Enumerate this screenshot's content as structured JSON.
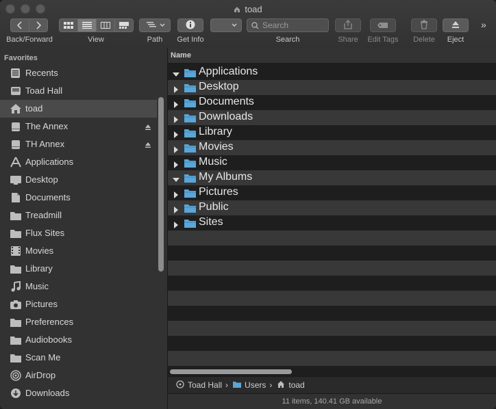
{
  "window": {
    "title": "toad"
  },
  "toolbar": {
    "back_forward_label": "Back/Forward",
    "view_label": "View",
    "path_label": "Path",
    "get_info_label": "Get Info",
    "search_label": "Search",
    "search_placeholder": "Search",
    "share_label": "Share",
    "edit_tags_label": "Edit Tags",
    "delete_label": "Delete",
    "eject_label": "Eject",
    "more_label": "»"
  },
  "sidebar": {
    "heading": "Favorites",
    "items": [
      {
        "label": "Recents",
        "icon": "recents-icon"
      },
      {
        "label": "Toad Hall",
        "icon": "disk-icon"
      },
      {
        "label": "toad",
        "icon": "home-icon",
        "selected": true
      },
      {
        "label": "The Annex",
        "icon": "drive-icon",
        "eject": true
      },
      {
        "label": "TH Annex",
        "icon": "drive-icon",
        "eject": true
      },
      {
        "label": "Applications",
        "icon": "applications-icon"
      },
      {
        "label": "Desktop",
        "icon": "desktop-icon"
      },
      {
        "label": "Documents",
        "icon": "document-icon"
      },
      {
        "label": "Treadmill",
        "icon": "folder-icon"
      },
      {
        "label": "Flux Sites",
        "icon": "folder-icon"
      },
      {
        "label": "Movies",
        "icon": "movies-icon"
      },
      {
        "label": "Library",
        "icon": "folder-icon"
      },
      {
        "label": "Music",
        "icon": "music-icon"
      },
      {
        "label": "Pictures",
        "icon": "camera-icon"
      },
      {
        "label": "Preferences",
        "icon": "folder-icon"
      },
      {
        "label": "Audiobooks",
        "icon": "folder-icon"
      },
      {
        "label": "Scan Me",
        "icon": "folder-icon"
      },
      {
        "label": "AirDrop",
        "icon": "airdrop-icon"
      },
      {
        "label": "Downloads",
        "icon": "downloads-icon"
      }
    ]
  },
  "list": {
    "column_name": "Name",
    "rows": [
      {
        "label": "Applications",
        "expanded": true
      },
      {
        "label": "Desktop",
        "expanded": false
      },
      {
        "label": "Documents",
        "expanded": false
      },
      {
        "label": "Downloads",
        "expanded": false
      },
      {
        "label": "Library",
        "expanded": false
      },
      {
        "label": "Movies",
        "expanded": false
      },
      {
        "label": "Music",
        "expanded": false
      },
      {
        "label": "My Albums",
        "expanded": true
      },
      {
        "label": "Pictures",
        "expanded": false
      },
      {
        "label": "Public",
        "expanded": false
      },
      {
        "label": "Sites",
        "expanded": false
      }
    ]
  },
  "pathbar": {
    "items": [
      "Toad Hall",
      "Users",
      "toad"
    ],
    "separator": "›"
  },
  "status": {
    "text": "11 items, 140.41 GB available"
  },
  "colors": {
    "folder": "#5aa6d8",
    "selected_row": "#4a4a4a",
    "stripe": "#383838"
  }
}
